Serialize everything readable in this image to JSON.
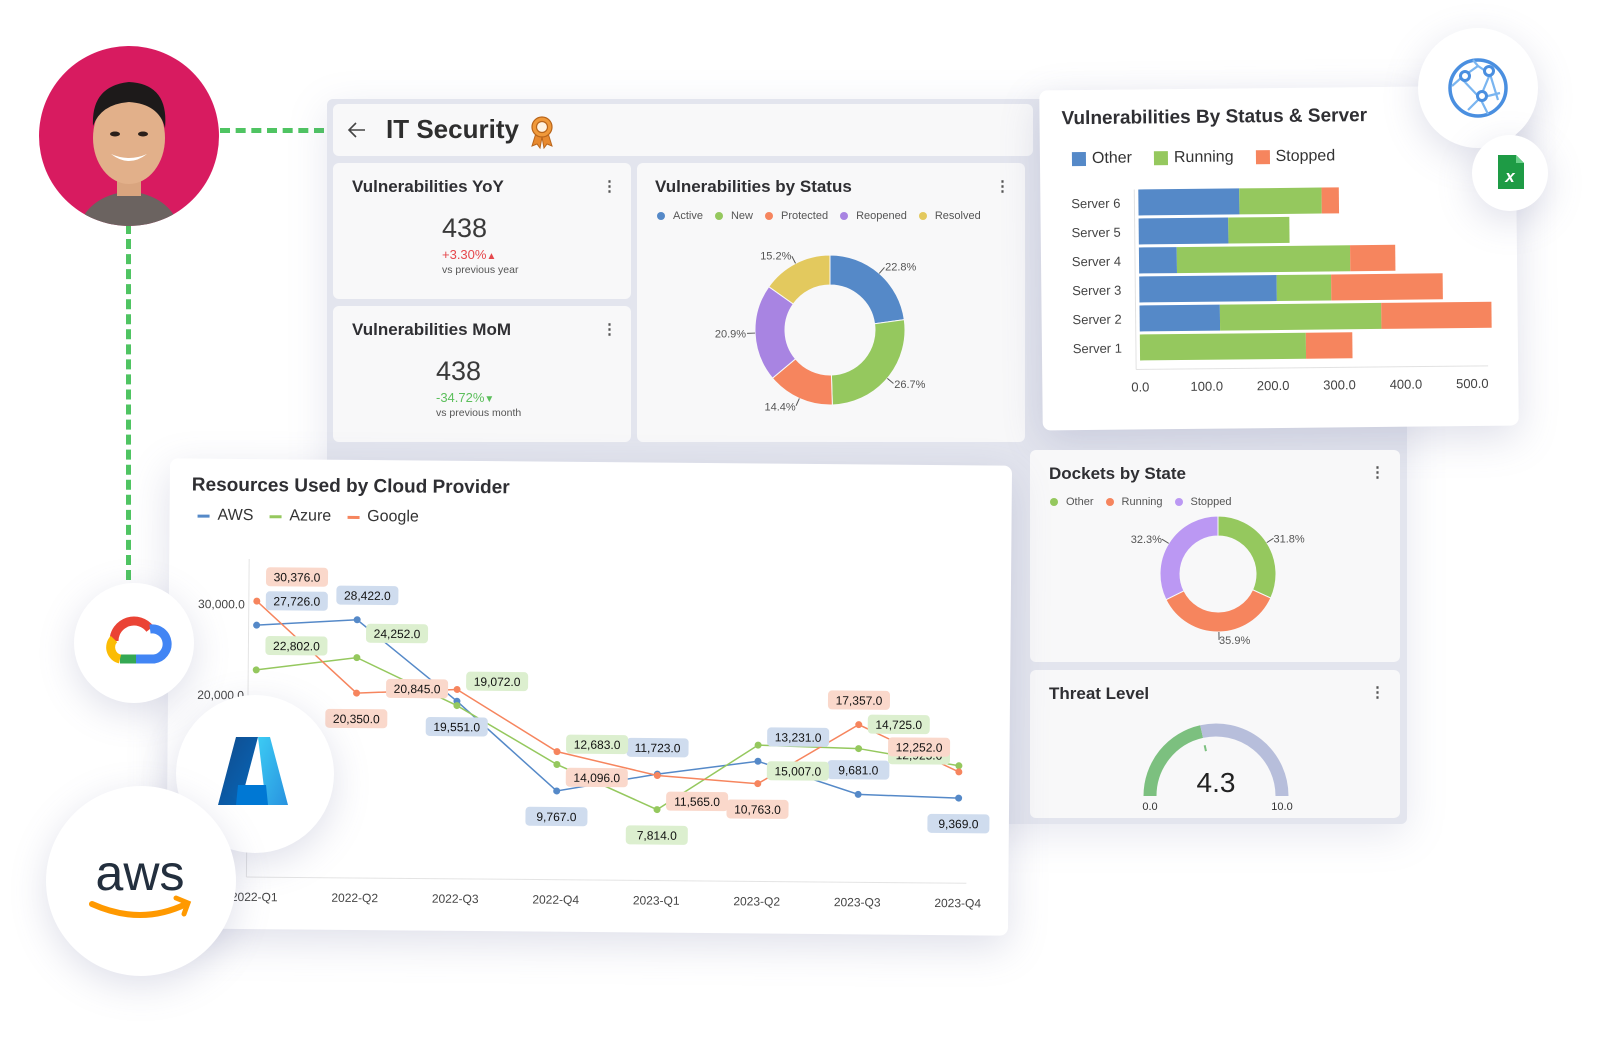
{
  "header": {
    "title": "IT Security",
    "back_icon": "arrow-left-icon",
    "badge_icon": "award-ribbon-icon"
  },
  "kpi_yoy": {
    "title": "Vulnerabilities YoY",
    "value": "438",
    "change": "+3.30%",
    "change_arrow": "▲",
    "change_color": "#e5484d",
    "subtitle": "vs previous year"
  },
  "kpi_mom": {
    "title": "Vulnerabilities MoM",
    "value": "438",
    "change": "-34.72%",
    "change_arrow": "▼",
    "change_color": "#5cbf5c",
    "subtitle": "vs previous month"
  },
  "avatar": {
    "icon": "user-avatar",
    "background": "#d81b60"
  },
  "integrations": [
    {
      "name": "network-globe-icon"
    },
    {
      "name": "excel-icon"
    },
    {
      "name": "google-cloud-logo"
    },
    {
      "name": "azure-logo"
    },
    {
      "name": "aws-logo",
      "text": "aws"
    }
  ],
  "chart_data": [
    {
      "id": "vuln_status",
      "type": "pie",
      "title": "Vulnerabilities by Status",
      "donut": true,
      "labels": [
        "Active",
        "New",
        "Protected",
        "Reopened",
        "Resolved"
      ],
      "values": [
        22.8,
        26.7,
        14.4,
        20.9,
        15.2
      ],
      "value_labels": [
        "22.8%",
        "26.7%",
        "14.4%",
        "20.9%",
        "15.2%"
      ],
      "colors": [
        "#5589c8",
        "#95c85e",
        "#f6855e",
        "#a884e2",
        "#e3c95e"
      ],
      "legend_position": "top-left"
    },
    {
      "id": "vuln_server",
      "type": "bar",
      "orientation": "horizontal",
      "stacked": true,
      "title": "Vulnerabilities By Status & Server",
      "categories": [
        "Server 6",
        "Server 5",
        "Server 4",
        "Server 3",
        "Server 2",
        "Server 1"
      ],
      "series": [
        {
          "name": "Other",
          "color": "#5589c8",
          "values": [
            152,
            135,
            57,
            207,
            121,
            0
          ]
        },
        {
          "name": "Running",
          "color": "#95c85e",
          "values": [
            124,
            92,
            261,
            82,
            243,
            250
          ]
        },
        {
          "name": "Stopped",
          "color": "#f6855e",
          "values": [
            26,
            0,
            68,
            168,
            166,
            70
          ]
        }
      ],
      "xlim": [
        0,
        500
      ],
      "xticks": [
        "0.0",
        "100.0",
        "200.0",
        "300.0",
        "400.0",
        "500.0"
      ],
      "legend_position": "top-left"
    },
    {
      "id": "dockets",
      "type": "pie",
      "title": "Dockets by State",
      "donut": true,
      "labels": [
        "Other",
        "Running",
        "Stopped"
      ],
      "values": [
        31.8,
        35.9,
        32.3
      ],
      "value_labels": [
        "31.8%",
        "35.9%",
        "32.3%"
      ],
      "colors": [
        "#95c85e",
        "#f6855e",
        "#bb98f3"
      ],
      "legend_position": "top-left"
    },
    {
      "id": "threat",
      "type": "gauge",
      "title": "Threat Level",
      "value": 4.3,
      "value_label": "4.3",
      "min": 0,
      "max": 10,
      "min_label": "0.0",
      "max_label": "10.0",
      "fill_color": "#7cc07f",
      "track_color": "#b7bedb"
    },
    {
      "id": "cloud",
      "type": "line",
      "title": "Resources Used by Cloud Provider",
      "categories": [
        "2022-Q1",
        "2022-Q2",
        "2022-Q3",
        "2022-Q4",
        "2023-Q1",
        "2023-Q2",
        "2023-Q3",
        "2023-Q4"
      ],
      "series": [
        {
          "name": "AWS",
          "color": "#5589c8",
          "label_bg": "#cfdcee",
          "values": [
            27726,
            28422,
            19551,
            9767,
            11723,
            13231,
            9681,
            9369
          ],
          "labels": [
            "27,726.0",
            "28,422.0",
            "19,551.0",
            "9,767.0",
            "11,723.0",
            "13,231.0",
            "9,681.0",
            "9,369.0"
          ]
        },
        {
          "name": "Azure",
          "color": "#95c85e",
          "label_bg": "#dcefcf",
          "values": [
            22802,
            24252,
            19072,
            12683,
            7814,
            15007,
            14725,
            12925
          ],
          "labels": [
            "22,802.0",
            "24,252.0",
            "19,072.0",
            "12,683.0",
            "7,814.0",
            "15,007.0",
            "14,725.0",
            "12,925.0"
          ]
        },
        {
          "name": "Google",
          "color": "#f6855e",
          "label_bg": "#fad8cb",
          "values": [
            30376,
            20350,
            20845,
            14096,
            11565,
            10763,
            17357,
            12252
          ],
          "labels": [
            "30,376.0",
            "20,350.0",
            "20,845.0",
            "14,096.0",
            "11,565.0",
            "10,763.0",
            "17,357.0",
            "12,252.0"
          ]
        }
      ],
      "yticks": [
        "30,000.0",
        "20,000.0"
      ],
      "ylim": [
        0,
        35000
      ],
      "legend_position": "top-left",
      "grid": false
    }
  ]
}
